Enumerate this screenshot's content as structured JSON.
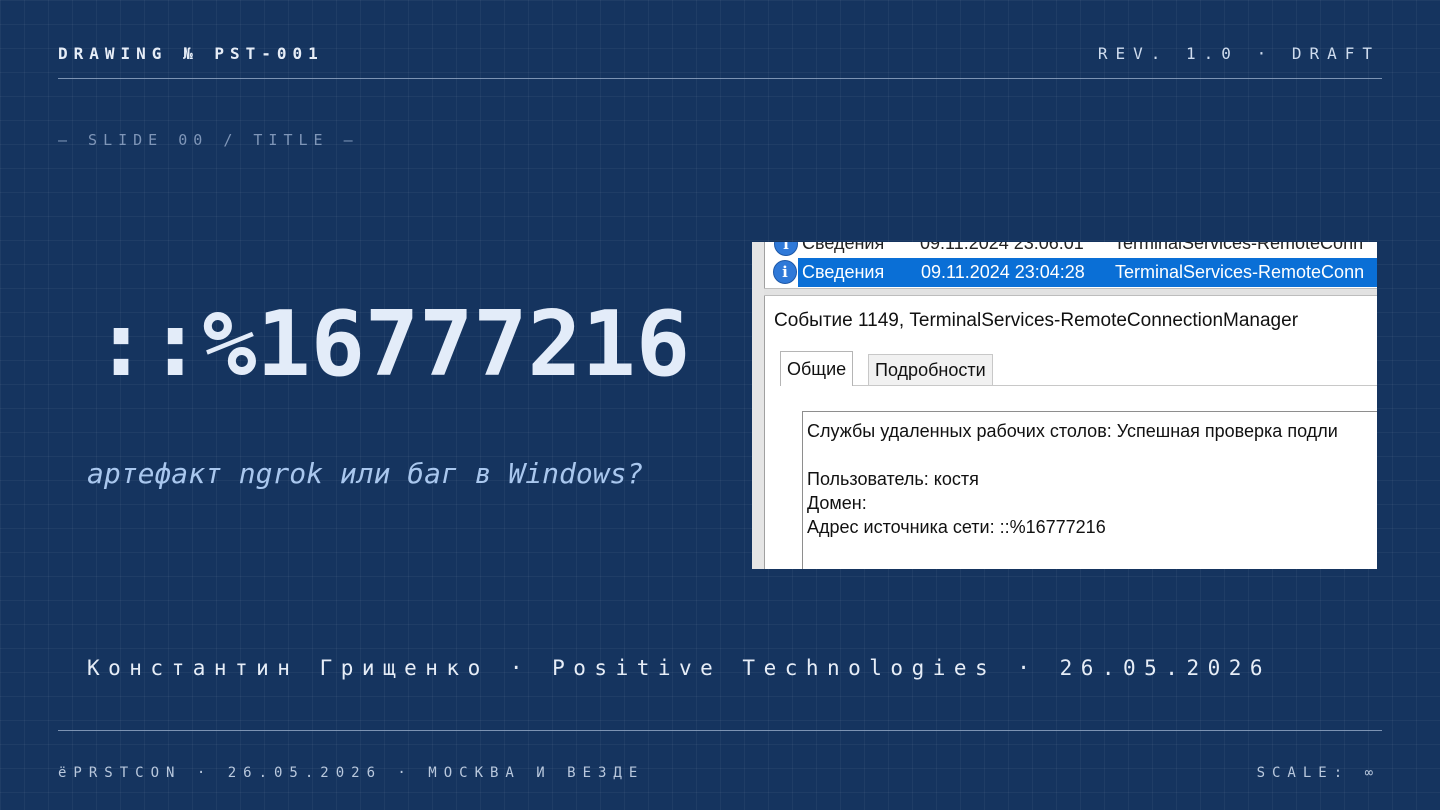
{
  "header": {
    "drawing": "DRAWING № PST-001",
    "revision": "REV. 1.0 · DRAFT"
  },
  "slide_label": "— SLIDE 00 / TITLE —",
  "title": "::%16777216",
  "subtitle": "артефакт ngrok или баг в Windows?",
  "author_line": "Константин Грищенко · Positive Technologies · 26.05.2026",
  "footer": {
    "left": "ёPRSTCON · 26.05.2026 · МОСКВА И ВЕЗДЕ",
    "right": "SCALE: ∞"
  },
  "screenshot": {
    "top_row": {
      "level": "Сведения",
      "datetime": "09.11.2024 23:06:01",
      "source": "TerminalServices-RemoteConn"
    },
    "selected_row": {
      "level": "Сведения",
      "datetime": "09.11.2024 23:04:28",
      "source": "TerminalServices-RemoteConn"
    },
    "event_title": "Событие 1149, TerminalServices-RemoteConnectionManager",
    "tabs": [
      "Общие",
      "Подробности"
    ],
    "message": {
      "line1": "Службы удаленных рабочих столов: Успешная проверка подли",
      "user": "Пользователь: костя",
      "domain": "Домен:",
      "address": "Адрес источника сети: ::%16777216"
    },
    "icon": "info-icon"
  },
  "colors": {
    "background": "#15345f",
    "selection": "#0a6fd6",
    "subtitle": "#a9c7ee"
  }
}
